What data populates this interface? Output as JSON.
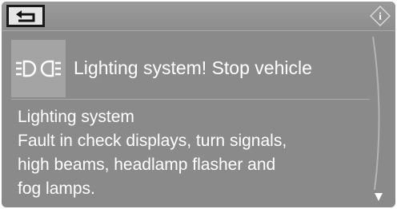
{
  "topbar": {
    "back_icon": "back-arrow-icon",
    "info_icon": "info-icon",
    "info_label": "i"
  },
  "message": {
    "icon": "lighting-system-warning-icon",
    "title": "Lighting system! Stop vehicle",
    "body_heading": "Lighting system",
    "body_lines": [
      "Fault in check displays, turn signals,",
      "high beams, headlamp flasher and",
      "fog lamps."
    ]
  },
  "scroll": {
    "indicator_icon": "scroll-down-arrow-icon"
  },
  "colors": {
    "background": "#8a8a8a",
    "text": "#ffffff",
    "highlight": "#a4a4a4"
  }
}
